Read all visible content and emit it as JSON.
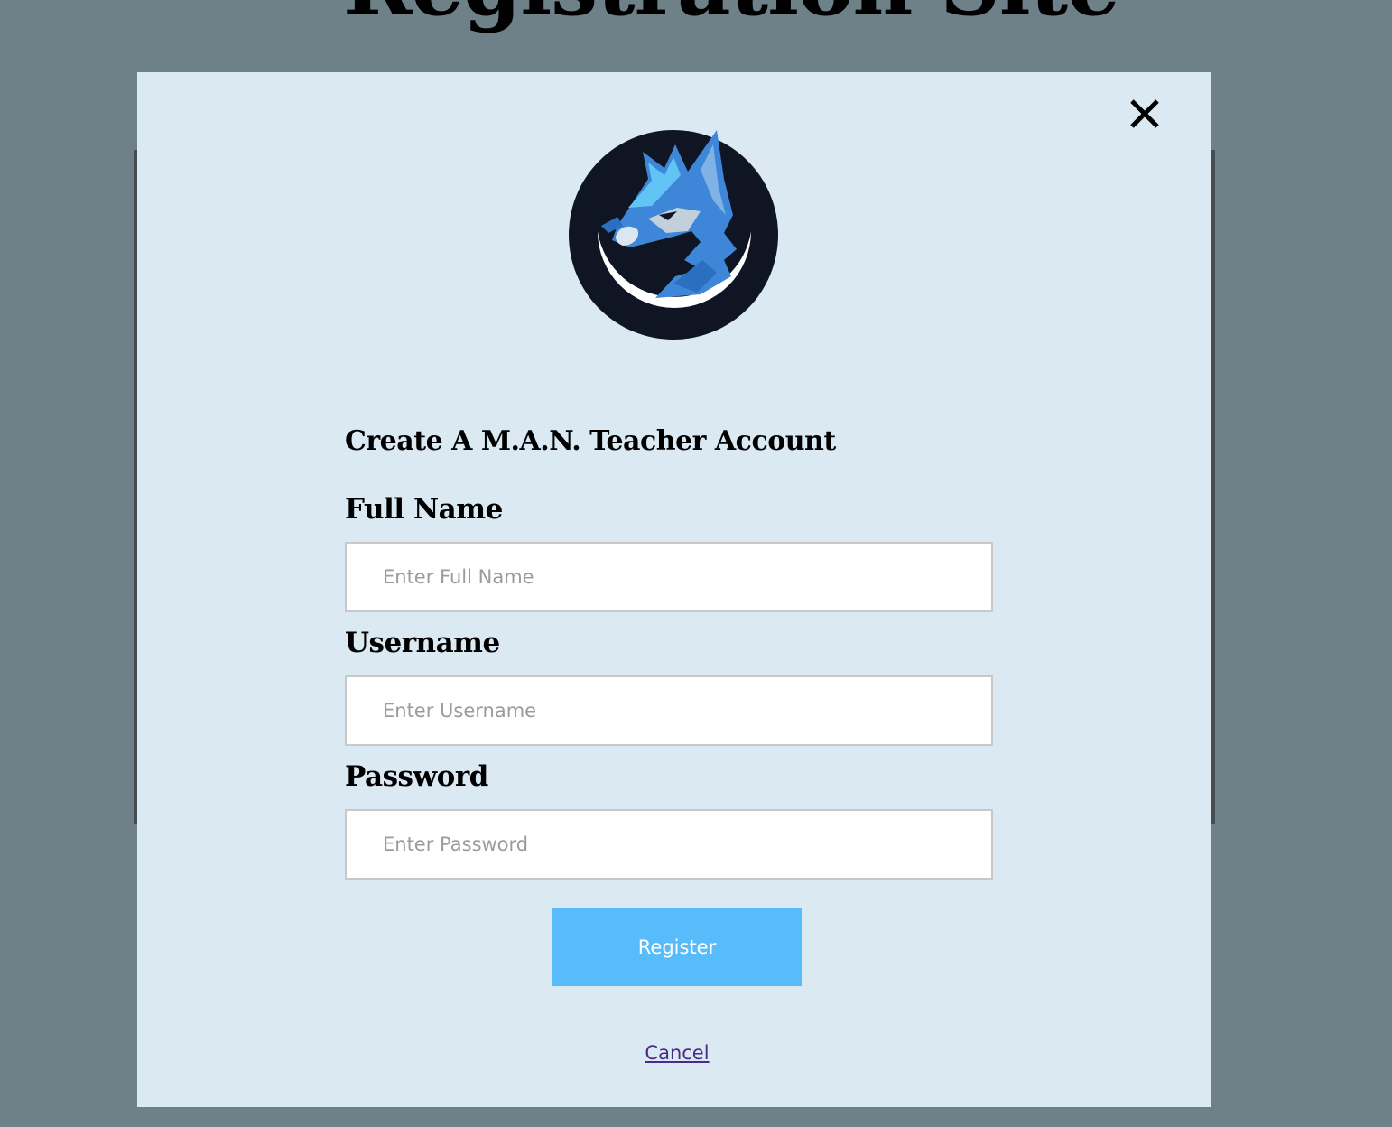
{
  "background": {
    "title": "Registration Site"
  },
  "modal": {
    "close_icon": "close-x-icon",
    "logo_icon": "wolf-mascot-logo",
    "title": "Create A M.A.N. Teacher Account",
    "fields": {
      "full_name": {
        "label": "Full Name",
        "placeholder": "Enter Full Name",
        "value": ""
      },
      "username": {
        "label": "Username",
        "placeholder": "Enter Username",
        "value": ""
      },
      "password": {
        "label": "Password",
        "placeholder": "Enter Password",
        "value": ""
      }
    },
    "register_label": "Register",
    "cancel_label": "Cancel"
  },
  "colors": {
    "page_background": "#6e8189",
    "modal_background": "#dbeaf2",
    "register_button": "#57bcf9",
    "cancel_link": "#4a2a8a"
  }
}
